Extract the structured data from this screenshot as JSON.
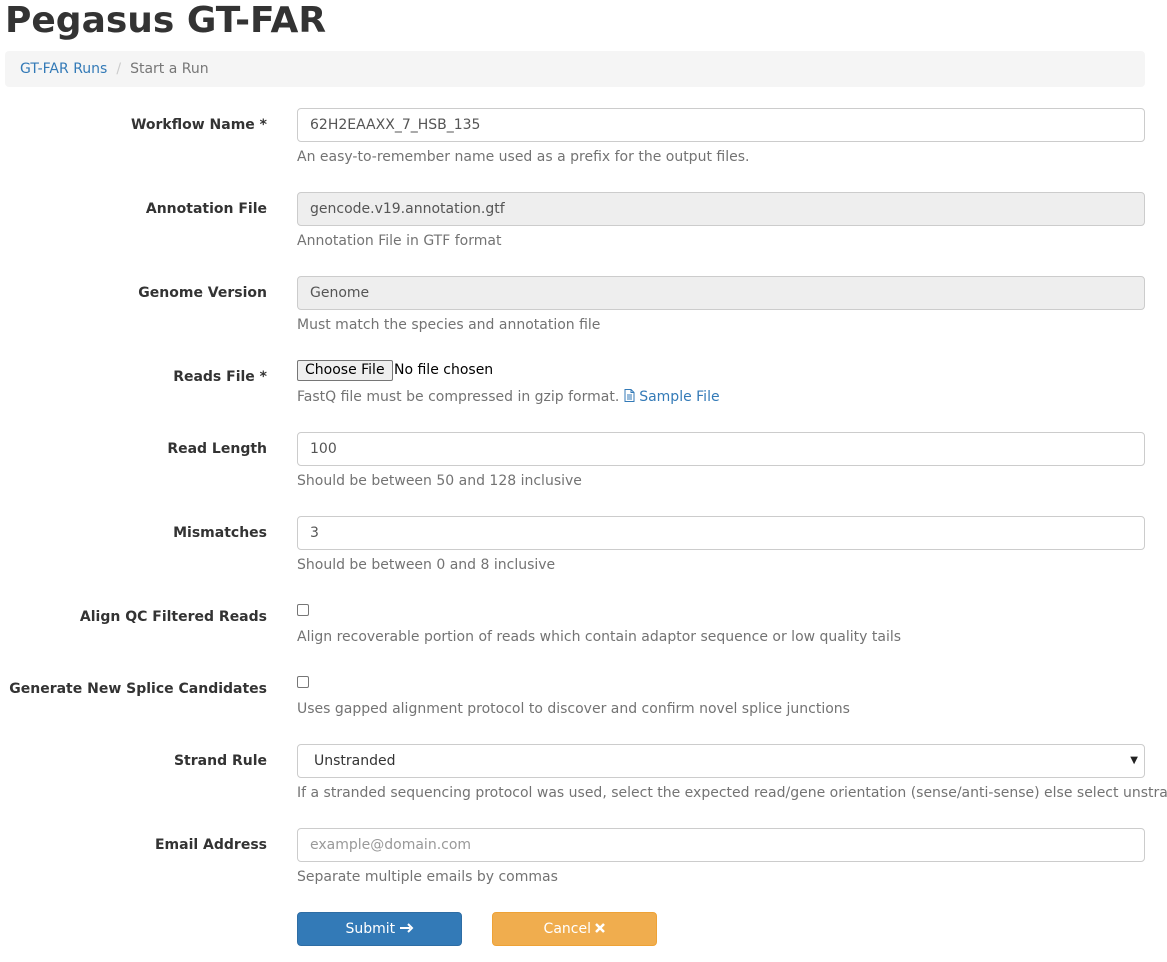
{
  "header": {
    "title": "Pegasus GT-FAR"
  },
  "breadcrumb": {
    "link": "GT-FAR Runs",
    "separator": "/",
    "current": "Start a Run"
  },
  "form": {
    "workflow_name": {
      "label": "Workflow Name *",
      "value": "62H2EAAXX_7_HSB_135",
      "help": "An easy-to-remember name used as a prefix for the output files."
    },
    "annotation_file": {
      "label": "Annotation File",
      "value": "gencode.v19.annotation.gtf",
      "help": "Annotation File in GTF format"
    },
    "genome_version": {
      "label": "Genome Version",
      "value": "Genome",
      "help": "Must match the species and annotation file"
    },
    "reads_file": {
      "label": "Reads File *",
      "button": "Choose File",
      "status": "No file chosen",
      "help": "FastQ file must be compressed in gzip format.",
      "sample_link": "Sample File"
    },
    "read_length": {
      "label": "Read Length",
      "value": "100",
      "help": "Should be between 50 and 128 inclusive"
    },
    "mismatches": {
      "label": "Mismatches",
      "value": "3",
      "help": "Should be between 0 and 8 inclusive"
    },
    "align_qc": {
      "label": "Align QC Filtered Reads",
      "checked": false,
      "help": "Align recoverable portion of reads which contain adaptor sequence or low quality tails"
    },
    "splice_candidates": {
      "label": "Generate New Splice Candidates",
      "checked": false,
      "help": "Uses gapped alignment protocol to discover and confirm novel splice junctions"
    },
    "strand_rule": {
      "label": "Strand Rule",
      "selected": "Unstranded",
      "help": "If a stranded sequencing protocol was used, select the expected read/gene orientation (sense/anti-sense) else select unstranded"
    },
    "email": {
      "label": "Email Address",
      "placeholder": "example@domain.com",
      "help": "Separate multiple emails by commas"
    }
  },
  "actions": {
    "submit": "Submit",
    "cancel": "Cancel"
  },
  "icons": {
    "submit_icon": "arrow-right-icon",
    "cancel_icon": "times-icon",
    "sample_icon": "file-text-icon",
    "select_arrow": "caret-down-icon"
  },
  "colors": {
    "primary": "#337ab7",
    "warning": "#f0ad4e",
    "link": "#337ab7",
    "readonly_bg": "#eeeeee"
  }
}
